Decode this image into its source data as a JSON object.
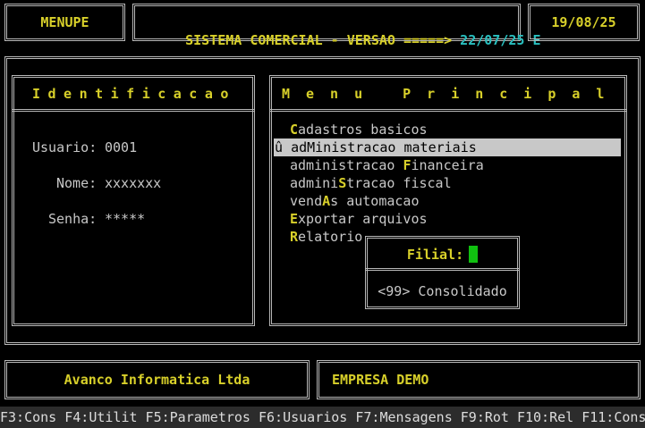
{
  "header": {
    "program": "MENUPE",
    "system_title": "SISTEMA COMERCIAL - VERSAO =====>",
    "version": "22/07/25 E",
    "date": "19/08/25"
  },
  "identification": {
    "title": "Identificacao",
    "user_label": "Usuario:",
    "user_value": "0001",
    "name_label": "Nome:",
    "name_value": "xxxxxxx",
    "password_label": "Senha:",
    "password_value": "*****"
  },
  "menu": {
    "title": "Menu Principal",
    "selected_marker": "û",
    "items": [
      {
        "pre": "",
        "key": "C",
        "post": "adastros basicos"
      },
      {
        "pre": "ad",
        "key": "M",
        "post": "inistracao materiais"
      },
      {
        "pre": "administracao ",
        "key": "F",
        "post": "inanceira"
      },
      {
        "pre": "admini",
        "key": "S",
        "post": "tracao fiscal"
      },
      {
        "pre": "vend",
        "key": "A",
        "post": "s automacao"
      },
      {
        "pre": "",
        "key": "E",
        "post": "xportar arquivos"
      },
      {
        "pre": "",
        "key": "R",
        "post": "elatorio"
      }
    ]
  },
  "filial_popup": {
    "label": "Filial:",
    "option": "<99> Consolidado"
  },
  "footer": {
    "company": "Avanco Informatica Ltda",
    "client": "EMPRESA DEMO"
  },
  "function_keys": "F3:Cons F4:Utilit F5:Parametros F6:Usuarios F7:Mensagens F9:Rot F10:Rel F11:Cons",
  "colors": {
    "accent_yellow": "#d8d02a",
    "accent_cyan": "#29c0c0",
    "cursor_green": "#10c010",
    "selection": "#c8c8c8"
  }
}
